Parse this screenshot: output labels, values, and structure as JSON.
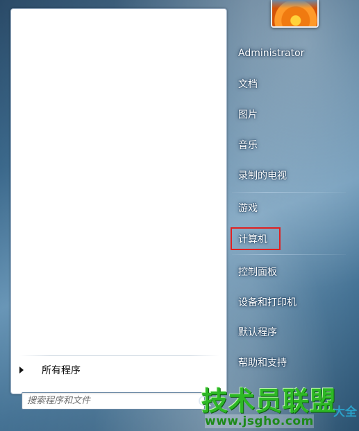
{
  "all_programs": {
    "label": "所有程序"
  },
  "search": {
    "placeholder": "搜索程序和文件"
  },
  "right_menu": {
    "items": [
      {
        "label": "Administrator"
      },
      {
        "label": "文档"
      },
      {
        "label": "图片"
      },
      {
        "label": "音乐"
      },
      {
        "label": "录制的电视"
      },
      {
        "label": "游戏"
      },
      {
        "label": "计算机",
        "highlighted": true
      },
      {
        "label": "控制面板"
      },
      {
        "label": "设备和打印机"
      },
      {
        "label": "默认程序"
      },
      {
        "label": "帮助和支持"
      }
    ]
  },
  "watermark": {
    "main": "技术员联盟",
    "side": "大全",
    "url": "www.jsgho.com"
  },
  "colors": {
    "highlight_border": "#e02020",
    "watermark_green": "#2db825"
  }
}
